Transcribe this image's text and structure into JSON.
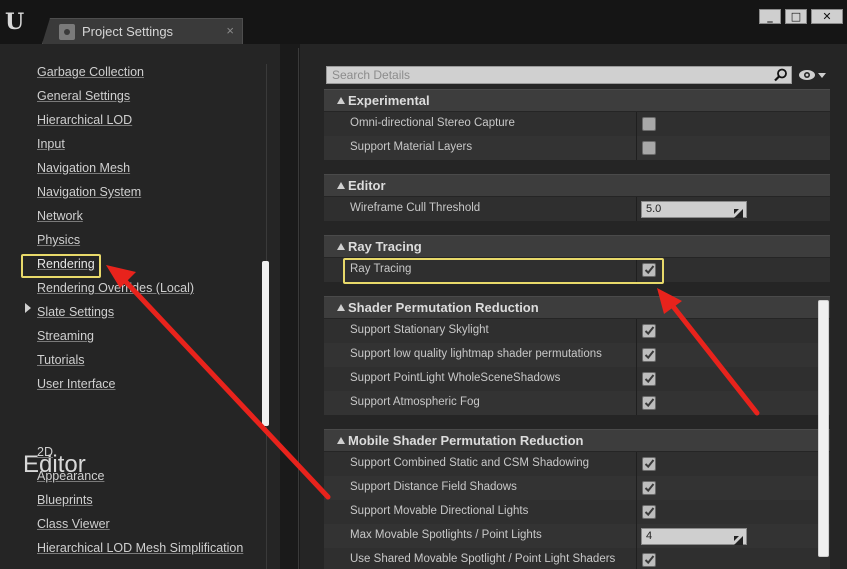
{
  "window": {
    "tab_title": "Project Settings",
    "tab_close": "×",
    "minimize": "_",
    "maximize": "□",
    "close": "✕"
  },
  "left_nav": {
    "items": [
      "Garbage Collection",
      "General Settings",
      "Hierarchical LOD",
      "Input",
      "Navigation Mesh",
      "Navigation System",
      "Network",
      "Physics",
      "Rendering",
      "Rendering Overrides (Local)",
      "Slate Settings",
      "Streaming",
      "Tutorials",
      "User Interface"
    ],
    "selected": "Rendering",
    "editor_heading": "Editor",
    "editor_items": [
      "2D",
      "Appearance",
      "Blueprints",
      "Class Viewer",
      "Hierarchical LOD Mesh Simplification"
    ]
  },
  "details": {
    "search_placeholder": "Search Details",
    "categories": [
      {
        "label": "Experimental",
        "rows": [
          {
            "label": "Omni-directional Stereo Capture",
            "type": "checkbox",
            "checked": false
          },
          {
            "label": "Support Material Layers",
            "type": "checkbox",
            "checked": false
          }
        ]
      },
      {
        "label": "Editor",
        "rows": [
          {
            "label": "Wireframe Cull Threshold",
            "type": "number",
            "value": "5.0"
          }
        ]
      },
      {
        "label": "Ray Tracing",
        "rows": [
          {
            "label": "Ray Tracing",
            "type": "checkbox",
            "checked": true
          }
        ]
      },
      {
        "label": "Shader Permutation Reduction",
        "rows": [
          {
            "label": "Support Stationary Skylight",
            "type": "checkbox",
            "checked": true
          },
          {
            "label": "Support low quality lightmap shader permutations",
            "type": "checkbox",
            "checked": true
          },
          {
            "label": "Support PointLight WholeSceneShadows",
            "type": "checkbox",
            "checked": true
          },
          {
            "label": "Support Atmospheric Fog",
            "type": "checkbox",
            "checked": true
          }
        ]
      },
      {
        "label": "Mobile Shader Permutation Reduction",
        "rows": [
          {
            "label": "Support Combined Static and CSM Shadowing",
            "type": "checkbox",
            "checked": true
          },
          {
            "label": "Support Distance Field Shadows",
            "type": "checkbox",
            "checked": true
          },
          {
            "label": "Support Movable Directional Lights",
            "type": "checkbox",
            "checked": true
          },
          {
            "label": "Max Movable Spotlights / Point Lights",
            "type": "number",
            "value": "4"
          },
          {
            "label": "Use Shared Movable Spotlight / Point Light Shaders",
            "type": "checkbox",
            "checked": true
          }
        ]
      }
    ]
  },
  "colors": {
    "highlight_box": "#e8d96a",
    "annotation_arrow": "#e8231c"
  }
}
